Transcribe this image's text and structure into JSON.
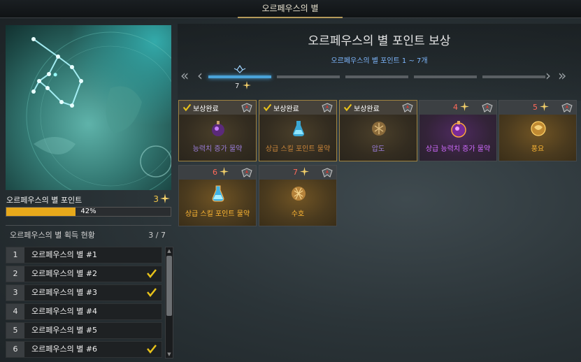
{
  "window": {
    "title": "오르페우스의 별"
  },
  "left": {
    "points_label": "오르페우스의 별 포인트",
    "points_value": "3",
    "progress_percent": 42,
    "progress_text": "42%",
    "collect_label": "오르페우스의 별 획득 현황",
    "collect_count": "3 / 7",
    "stars": [
      {
        "num": "1",
        "name": "오르페우스의 별 #1",
        "checked": false
      },
      {
        "num": "2",
        "name": "오르페우스의 별 #2",
        "checked": true
      },
      {
        "num": "3",
        "name": "오르페우스의 별 #3",
        "checked": true
      },
      {
        "num": "4",
        "name": "오르페우스의 별 #4",
        "checked": false
      },
      {
        "num": "5",
        "name": "오르페우스의 별 #5",
        "checked": false
      },
      {
        "num": "6",
        "name": "오르페우스의 별 #6",
        "checked": true
      }
    ]
  },
  "reward": {
    "title": "오르페우스의 별 포인트 보상",
    "subtitle": "오르페우스의 별 포인트 1 ~ 7개",
    "page_count": "7",
    "cards": [
      {
        "claimed": true,
        "status": "보상완료",
        "item": "능력치 증가 물약"
      },
      {
        "claimed": true,
        "status": "보상완료",
        "item": "상급 스킬 포인트 물약"
      },
      {
        "claimed": true,
        "status": "보상완료",
        "item": "압도"
      },
      {
        "claimed": false,
        "required": "4",
        "item": "상급 능력치 증가 물약"
      },
      {
        "claimed": false,
        "required": "5",
        "item": "풍요"
      },
      {
        "claimed": false,
        "required": "6",
        "item": "상급 스킬 포인트 물약"
      },
      {
        "claimed": false,
        "required": "7",
        "item": "수호"
      }
    ]
  },
  "colors": {
    "accent_gold": "#f4c84a",
    "progress": "#e7a91b",
    "required_red": "#ff6a5a",
    "link_blue": "#7fb8ff"
  },
  "icons": [
    "star-icon",
    "check-icon",
    "emblem-icon",
    "chevron-left-icon",
    "chevron-right-icon",
    "potion-icon",
    "engraving-icon"
  ]
}
